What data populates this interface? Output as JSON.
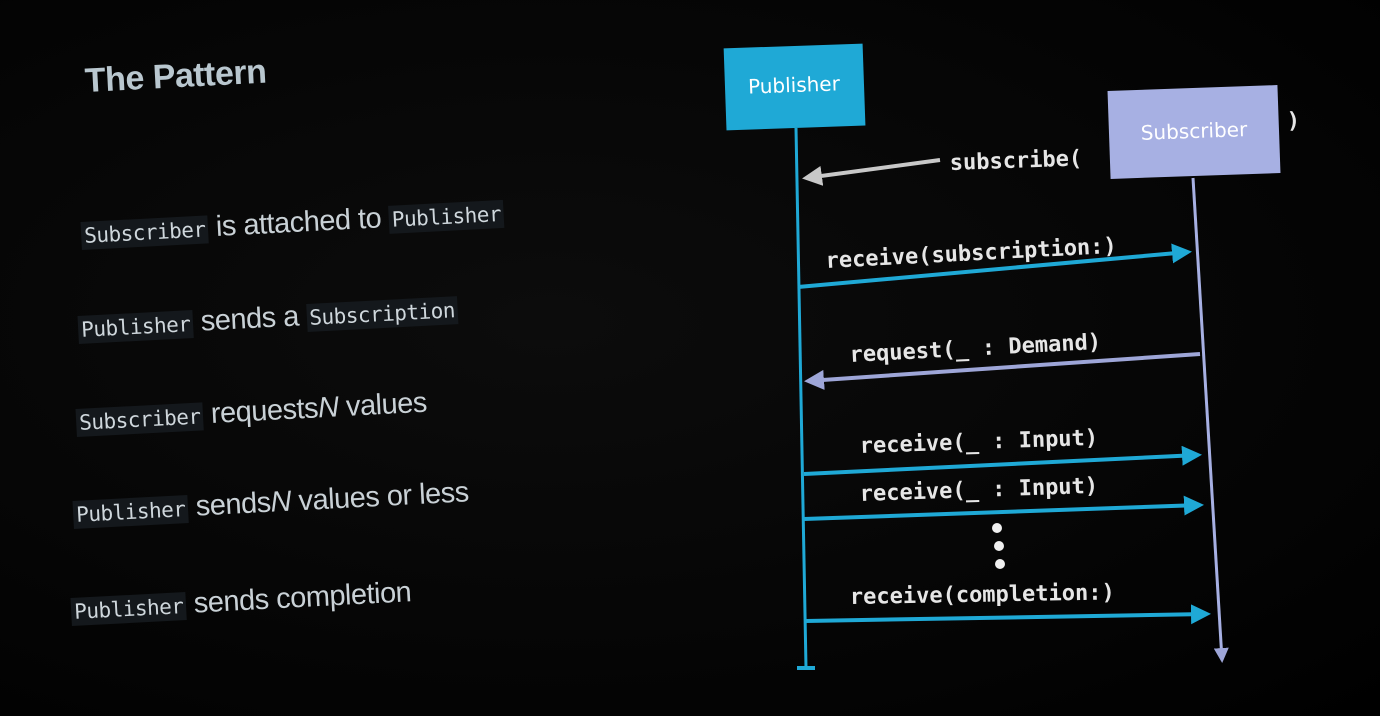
{
  "slide": {
    "title": "The Pattern",
    "bullets": [
      {
        "subject": "Subscriber",
        "text": "is attached to",
        "object": "Publisher"
      },
      {
        "subject": "Publisher",
        "text": "sends a",
        "object": "Subscription"
      },
      {
        "subject": "Subscriber",
        "text_before": "requests",
        "emphasis": "N",
        "text_after": "values"
      },
      {
        "subject": "Publisher",
        "text_before": "sends",
        "emphasis": "N",
        "text_after": "values or less"
      },
      {
        "subject": "Publisher",
        "text": "sends completion"
      }
    ]
  },
  "diagram": {
    "publisher_label": "Publisher",
    "subscriber_label": "Subscriber",
    "subscribe_open": "subscribe(",
    "subscribe_close": ")",
    "messages": [
      {
        "label": "receive(subscription:)",
        "direction": "to-subscriber"
      },
      {
        "label": "request(_ : Demand)",
        "direction": "to-publisher"
      },
      {
        "label": "receive(_ : Input)",
        "direction": "to-subscriber"
      },
      {
        "label": "receive(_ : Input)",
        "direction": "to-subscriber"
      },
      {
        "label": "receive(completion:)",
        "direction": "to-subscriber"
      }
    ],
    "colors": {
      "publisher": "#1fa9d6",
      "subscriber": "#a7b0e3",
      "request_arrow": "#9ea6d8",
      "subscribe_arrow": "#c8c8c8"
    }
  }
}
